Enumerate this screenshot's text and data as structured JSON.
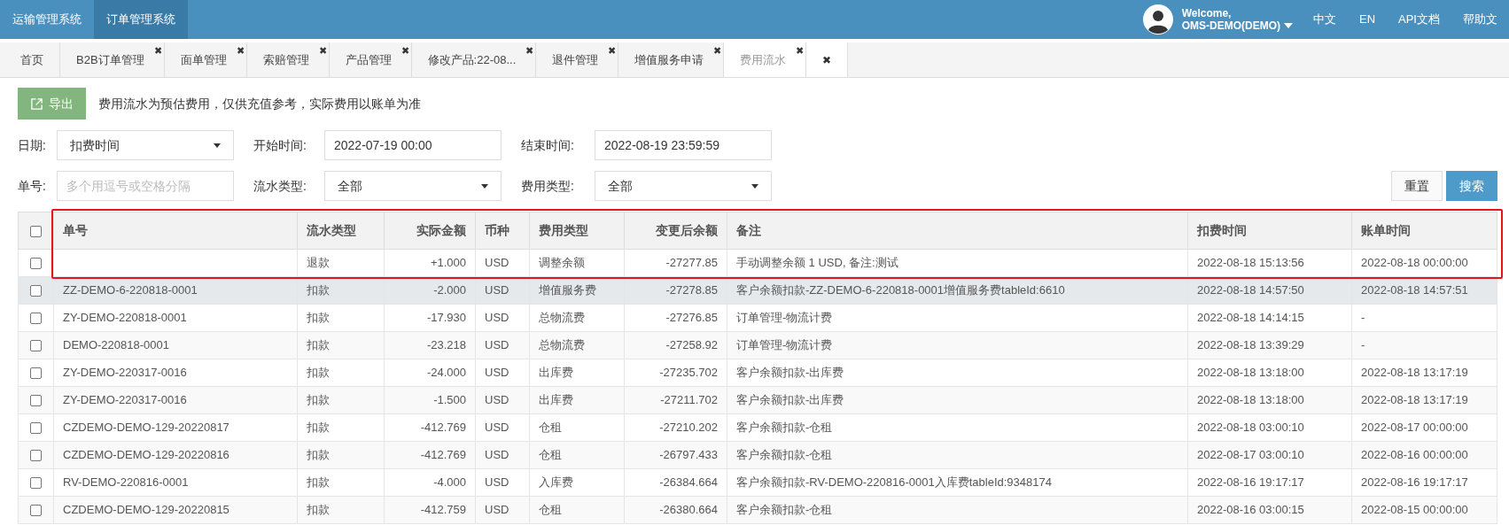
{
  "top_bar": {
    "systems": [
      {
        "label": "运输管理系统",
        "selected": false
      },
      {
        "label": "订单管理系统",
        "selected": true
      }
    ],
    "user": {
      "greeting": "Welcome,",
      "name": "OMS-DEMO(DEMO)"
    },
    "links": [
      "中文",
      "EN",
      "API文档",
      "帮助文"
    ]
  },
  "tabs": [
    {
      "label": "首页",
      "selected": false
    },
    {
      "label": "B2B订单管理",
      "selected": false,
      "close_icon": "✖"
    },
    {
      "label": "面单管理",
      "selected": false,
      "close_icon": "✖"
    },
    {
      "label": "索赔管理",
      "selected": false,
      "close_icon": "✖"
    },
    {
      "label": "产品管理",
      "selected": false,
      "close_icon": "✖"
    },
    {
      "label": "修改产品:22-08...",
      "selected": false,
      "close_icon": "✖"
    },
    {
      "label": "退件管理",
      "selected": false,
      "close_icon": "✖"
    },
    {
      "label": "增值服务申请",
      "selected": false,
      "close_icon": "✖"
    },
    {
      "label": "费用流水",
      "selected": true,
      "close_icon": "✖"
    }
  ],
  "close_all": "✖",
  "toolbar": {
    "export_button": "导出",
    "notice": "费用流水为预估费用，仅供充值参考，实际费用以账单为准"
  },
  "filters": [
    {
      "kind": "select",
      "label": "日期:",
      "value": "扣费时间"
    },
    {
      "kind": "input",
      "label": "开始时间:",
      "value": "2022-07-19 00:00"
    },
    {
      "kind": "input",
      "label": "结束时间:",
      "value": "2022-08-19 23:59:59"
    },
    {
      "kind": "input",
      "label": "单号:",
      "placeholder": "多个用逗号或空格分隔"
    },
    {
      "kind": "select",
      "label": "流水类型:",
      "value": "全部"
    },
    {
      "kind": "select",
      "label": "费用类型:",
      "value": "全部"
    }
  ],
  "buttons": {
    "reset": "重置",
    "search": "搜索"
  },
  "table": {
    "select_all_checked": false,
    "columns": [
      "单号",
      "流水类型",
      "实际金额",
      "币种",
      "费用类型",
      "变更后余额",
      "备注",
      "扣费时间",
      "账单时间"
    ],
    "rows": [
      {
        "checked": false,
        "hovered": false,
        "highlighted": true,
        "cells": [
          "",
          "退款",
          "+1.000",
          "USD",
          "调整余额",
          "-27277.85",
          "手动调整余额 1 USD, 备注:测试",
          "2022-08-18 15:13:56",
          "2022-08-18 00:00:00"
        ]
      },
      {
        "checked": false,
        "hovered": true,
        "highlighted": false,
        "cells": [
          "ZZ-DEMO-6-220818-0001",
          "扣款",
          "-2.000",
          "USD",
          "增值服务费",
          "-27278.85",
          "客户余额扣款-ZZ-DEMO-6-220818-0001增值服务费tableId:6610",
          "2022-08-18 14:57:50",
          "2022-08-18 14:57:51"
        ]
      },
      {
        "checked": false,
        "hovered": false,
        "highlighted": false,
        "cells": [
          "ZY-DEMO-220818-0001",
          "扣款",
          "-17.930",
          "USD",
          "总物流费",
          "-27276.85",
          "订单管理-物流计费",
          "2022-08-18 14:14:15",
          "-"
        ]
      },
      {
        "checked": false,
        "hovered": false,
        "highlighted": false,
        "cells": [
          "DEMO-220818-0001",
          "扣款",
          "-23.218",
          "USD",
          "总物流费",
          "-27258.92",
          "订单管理-物流计费",
          "2022-08-18 13:39:29",
          "-"
        ]
      },
      {
        "checked": false,
        "hovered": false,
        "highlighted": false,
        "cells": [
          "ZY-DEMO-220317-0016",
          "扣款",
          "-24.000",
          "USD",
          "出库费",
          "-27235.702",
          "客户余额扣款-出库费",
          "2022-08-18 13:18:00",
          "2022-08-18 13:17:19"
        ]
      },
      {
        "checked": false,
        "hovered": false,
        "highlighted": false,
        "cells": [
          "ZY-DEMO-220317-0016",
          "扣款",
          "-1.500",
          "USD",
          "出库费",
          "-27211.702",
          "客户余额扣款-出库费",
          "2022-08-18 13:18:00",
          "2022-08-18 13:17:19"
        ]
      },
      {
        "checked": false,
        "hovered": false,
        "highlighted": false,
        "cells": [
          "CZDEMO-DEMO-129-20220817",
          "扣款",
          "-412.769",
          "USD",
          "仓租",
          "-27210.202",
          "客户余额扣款-仓租",
          "2022-08-18 03:00:10",
          "2022-08-17 00:00:00"
        ]
      },
      {
        "checked": false,
        "hovered": false,
        "highlighted": false,
        "cells": [
          "CZDEMO-DEMO-129-20220816",
          "扣款",
          "-412.769",
          "USD",
          "仓租",
          "-26797.433",
          "客户余额扣款-仓租",
          "2022-08-17 03:00:10",
          "2022-08-16 00:00:00"
        ]
      },
      {
        "checked": false,
        "hovered": false,
        "highlighted": false,
        "cells": [
          "RV-DEMO-220816-0001",
          "扣款",
          "-4.000",
          "USD",
          "入库费",
          "-26384.664",
          "客户余额扣款-RV-DEMO-220816-0001入库费tableId:9348174",
          "2022-08-16 19:17:17",
          "2022-08-16 19:17:17"
        ]
      },
      {
        "checked": false,
        "hovered": false,
        "highlighted": false,
        "cells": [
          "CZDEMO-DEMO-129-20220815",
          "扣款",
          "-412.759",
          "USD",
          "仓租",
          "-26380.664",
          "客户余额扣款-仓租",
          "2022-08-16 03:00:15",
          "2022-08-15 00:00:00"
        ]
      }
    ]
  }
}
